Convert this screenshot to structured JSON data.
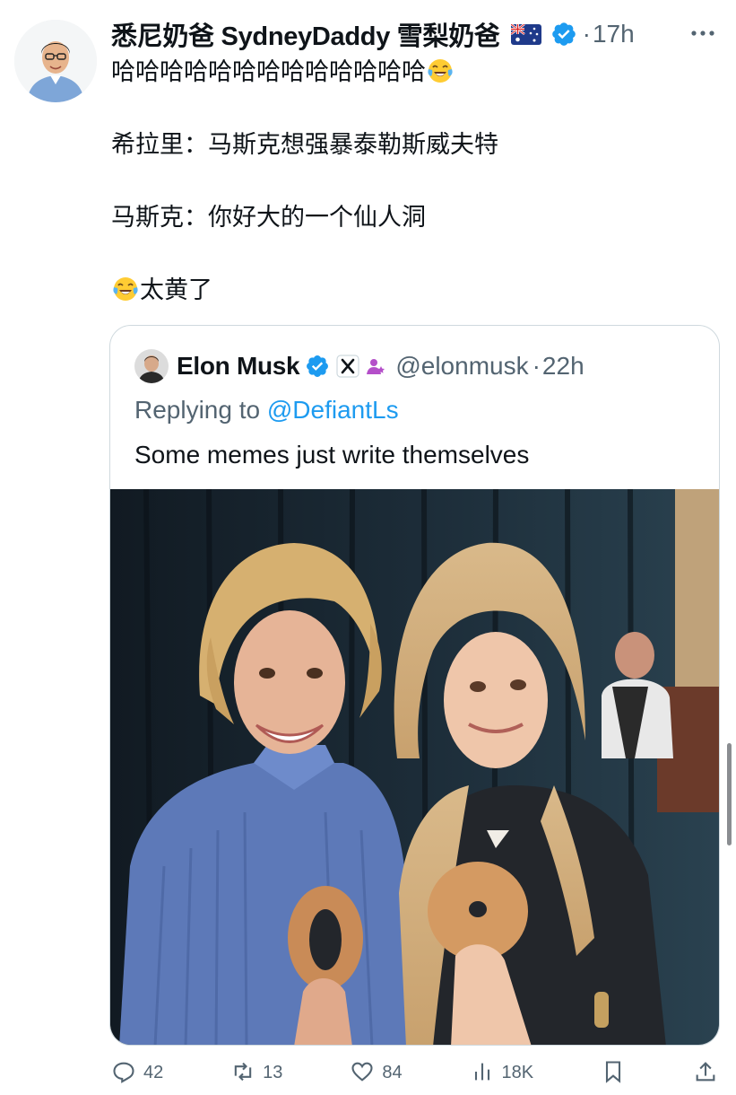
{
  "tweet": {
    "author": {
      "display_name": "悉尼奶爸 SydneyDaddy 雪梨奶爸",
      "flag_icon": "australia-flag-icon",
      "verified_icon": "verified-badge-icon"
    },
    "time": "17h",
    "text_lines": [
      "哈哈哈哈哈哈哈哈哈哈哈哈哈",
      "希拉里：马斯克想强暴泰勒斯威夫特",
      "马斯克：你好大的一个仙人洞",
      "太黄了"
    ],
    "emoji": "face-with-tears-of-joy-emoji"
  },
  "quote": {
    "author": {
      "display_name": "Elon Musk",
      "handle": "@elonmusk",
      "verified_icon": "verified-badge-icon",
      "affiliation_icon": "x-logo-icon"
    },
    "time": "22h",
    "replying_prefix": "Replying to ",
    "replying_to": "@DefiantLs",
    "text": "Some memes just write themselves",
    "media": "photo"
  },
  "actions": {
    "replies": "42",
    "reposts": "13",
    "likes": "84",
    "views": "18K"
  },
  "colors": {
    "accent": "#1d9bf0",
    "secondary_text": "#536471",
    "border": "#cfd9de"
  }
}
